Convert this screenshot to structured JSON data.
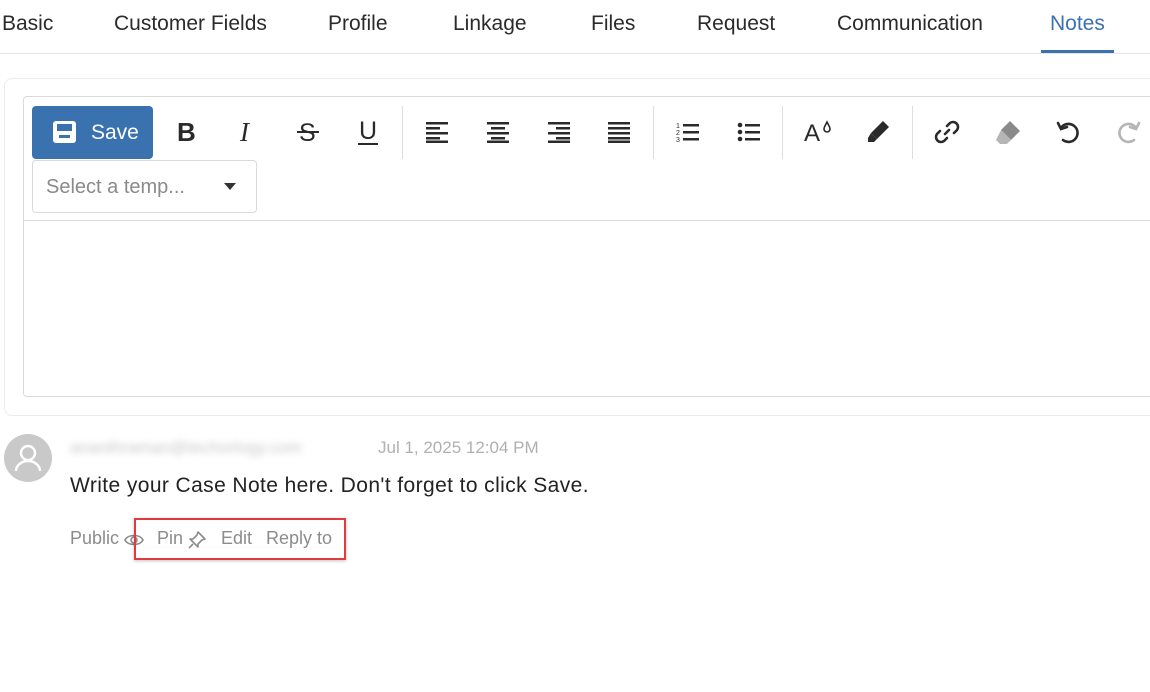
{
  "tabs": [
    {
      "label": "Basic",
      "active": false
    },
    {
      "label": "Customer Fields",
      "active": false
    },
    {
      "label": "Profile",
      "active": false
    },
    {
      "label": "Linkage",
      "active": false
    },
    {
      "label": "Files",
      "active": false
    },
    {
      "label": "Request",
      "active": false
    },
    {
      "label": "Communication",
      "active": false
    },
    {
      "label": "Notes",
      "active": true
    }
  ],
  "editor": {
    "save_label": "Save",
    "template_placeholder": "Select a temp...",
    "toolbar_icons": [
      "bold-icon",
      "italic-icon",
      "strikethrough-icon",
      "underline-icon",
      "align-left-icon",
      "align-center-icon",
      "align-right-icon",
      "align-justify-icon",
      "ordered-list-icon",
      "unordered-list-icon",
      "font-color-icon",
      "highlighter-icon",
      "link-icon",
      "eraser-icon",
      "undo-icon",
      "redo-icon"
    ]
  },
  "note": {
    "author": "ananthraman@techorlogy.com",
    "timestamp": "Jul 1, 2025 12:04 PM",
    "body": "Write your Case Note here. Don't forget to click Save.",
    "visibility": "Public",
    "actions": {
      "pin": "Pin",
      "edit": "Edit",
      "reply": "Reply to"
    }
  },
  "colors": {
    "accent": "#3a72b0",
    "highlight": "#e0393e"
  }
}
